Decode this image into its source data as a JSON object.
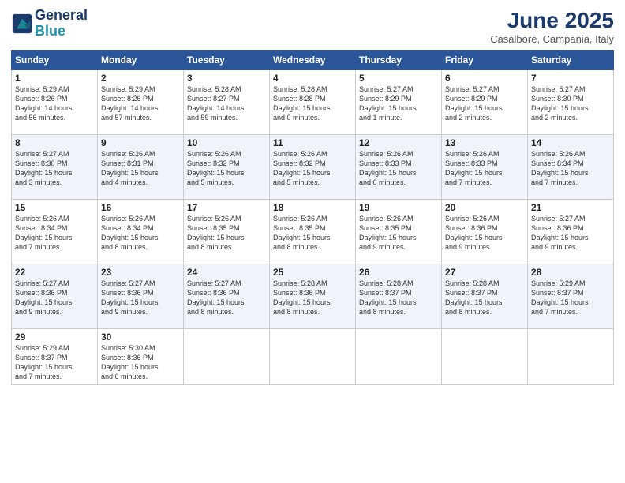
{
  "logo": {
    "line1": "General",
    "line2": "Blue"
  },
  "title": "June 2025",
  "location": "Casalbore, Campania, Italy",
  "weekdays": [
    "Sunday",
    "Monday",
    "Tuesday",
    "Wednesday",
    "Thursday",
    "Friday",
    "Saturday"
  ],
  "weeks": [
    [
      {
        "day": "1",
        "sunrise": "5:29 AM",
        "sunset": "8:26 PM",
        "daylight": "14 hours and 56 minutes."
      },
      {
        "day": "2",
        "sunrise": "5:29 AM",
        "sunset": "8:26 PM",
        "daylight": "14 hours and 57 minutes."
      },
      {
        "day": "3",
        "sunrise": "5:28 AM",
        "sunset": "8:27 PM",
        "daylight": "14 hours and 59 minutes."
      },
      {
        "day": "4",
        "sunrise": "5:28 AM",
        "sunset": "8:28 PM",
        "daylight": "15 hours and 0 minutes."
      },
      {
        "day": "5",
        "sunrise": "5:27 AM",
        "sunset": "8:29 PM",
        "daylight": "15 hours and 1 minute."
      },
      {
        "day": "6",
        "sunrise": "5:27 AM",
        "sunset": "8:29 PM",
        "daylight": "15 hours and 2 minutes."
      },
      {
        "day": "7",
        "sunrise": "5:27 AM",
        "sunset": "8:30 PM",
        "daylight": "15 hours and 2 minutes."
      }
    ],
    [
      {
        "day": "8",
        "sunrise": "5:27 AM",
        "sunset": "8:30 PM",
        "daylight": "15 hours and 3 minutes."
      },
      {
        "day": "9",
        "sunrise": "5:26 AM",
        "sunset": "8:31 PM",
        "daylight": "15 hours and 4 minutes."
      },
      {
        "day": "10",
        "sunrise": "5:26 AM",
        "sunset": "8:32 PM",
        "daylight": "15 hours and 5 minutes."
      },
      {
        "day": "11",
        "sunrise": "5:26 AM",
        "sunset": "8:32 PM",
        "daylight": "15 hours and 5 minutes."
      },
      {
        "day": "12",
        "sunrise": "5:26 AM",
        "sunset": "8:33 PM",
        "daylight": "15 hours and 6 minutes."
      },
      {
        "day": "13",
        "sunrise": "5:26 AM",
        "sunset": "8:33 PM",
        "daylight": "15 hours and 7 minutes."
      },
      {
        "day": "14",
        "sunrise": "5:26 AM",
        "sunset": "8:34 PM",
        "daylight": "15 hours and 7 minutes."
      }
    ],
    [
      {
        "day": "15",
        "sunrise": "5:26 AM",
        "sunset": "8:34 PM",
        "daylight": "15 hours and 7 minutes."
      },
      {
        "day": "16",
        "sunrise": "5:26 AM",
        "sunset": "8:34 PM",
        "daylight": "15 hours and 8 minutes."
      },
      {
        "day": "17",
        "sunrise": "5:26 AM",
        "sunset": "8:35 PM",
        "daylight": "15 hours and 8 minutes."
      },
      {
        "day": "18",
        "sunrise": "5:26 AM",
        "sunset": "8:35 PM",
        "daylight": "15 hours and 8 minutes."
      },
      {
        "day": "19",
        "sunrise": "5:26 AM",
        "sunset": "8:35 PM",
        "daylight": "15 hours and 9 minutes."
      },
      {
        "day": "20",
        "sunrise": "5:26 AM",
        "sunset": "8:36 PM",
        "daylight": "15 hours and 9 minutes."
      },
      {
        "day": "21",
        "sunrise": "5:27 AM",
        "sunset": "8:36 PM",
        "daylight": "15 hours and 9 minutes."
      }
    ],
    [
      {
        "day": "22",
        "sunrise": "5:27 AM",
        "sunset": "8:36 PM",
        "daylight": "15 hours and 9 minutes."
      },
      {
        "day": "23",
        "sunrise": "5:27 AM",
        "sunset": "8:36 PM",
        "daylight": "15 hours and 9 minutes."
      },
      {
        "day": "24",
        "sunrise": "5:27 AM",
        "sunset": "8:36 PM",
        "daylight": "15 hours and 8 minutes."
      },
      {
        "day": "25",
        "sunrise": "5:28 AM",
        "sunset": "8:36 PM",
        "daylight": "15 hours and 8 minutes."
      },
      {
        "day": "26",
        "sunrise": "5:28 AM",
        "sunset": "8:37 PM",
        "daylight": "15 hours and 8 minutes."
      },
      {
        "day": "27",
        "sunrise": "5:28 AM",
        "sunset": "8:37 PM",
        "daylight": "15 hours and 8 minutes."
      },
      {
        "day": "28",
        "sunrise": "5:29 AM",
        "sunset": "8:37 PM",
        "daylight": "15 hours and 7 minutes."
      }
    ],
    [
      {
        "day": "29",
        "sunrise": "5:29 AM",
        "sunset": "8:37 PM",
        "daylight": "15 hours and 7 minutes."
      },
      {
        "day": "30",
        "sunrise": "5:30 AM",
        "sunset": "8:36 PM",
        "daylight": "15 hours and 6 minutes."
      },
      null,
      null,
      null,
      null,
      null
    ]
  ]
}
